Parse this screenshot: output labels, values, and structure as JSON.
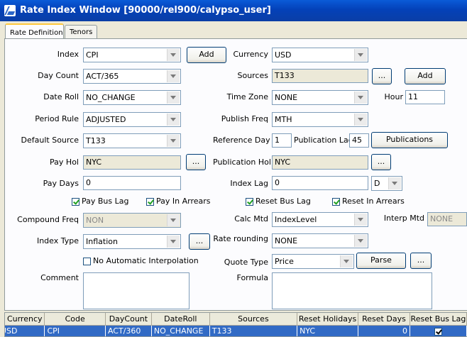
{
  "window": {
    "title": "Rate Index Window  [90000/rel900/calypso_user]"
  },
  "tabs": [
    {
      "label": "Rate Definition"
    },
    {
      "label": "Tenors"
    }
  ],
  "left": {
    "index": {
      "label": "Index",
      "value": "CPI",
      "button": "Add"
    },
    "day_count": {
      "label": "Day Count",
      "value": "ACT/365"
    },
    "date_roll": {
      "label": "Date Roll",
      "value": "NO_CHANGE"
    },
    "period_rule": {
      "label": "Period Rule",
      "value": "ADJUSTED"
    },
    "default_source": {
      "label": "Default Source",
      "value": "T133"
    },
    "pay_hol": {
      "label": "Pay Hol",
      "value": "NYC",
      "button": "..."
    },
    "pay_days": {
      "label": "Pay Days",
      "value": "0"
    },
    "pay_bus_lag": {
      "label": "Pay Bus Lag",
      "checked": true
    },
    "pay_in_arrears": {
      "label": "Pay In Arrears",
      "checked": true
    },
    "compound_freq": {
      "label": "Compound Freq",
      "value": "NON"
    },
    "index_type": {
      "label": "Index Type",
      "value": "Inflation",
      "button": "..."
    },
    "no_auto_interp": {
      "label": "No Automatic Interpolation",
      "checked": false
    },
    "comment": {
      "label": "Comment",
      "value": ""
    }
  },
  "right": {
    "currency": {
      "label": "Currency",
      "value": "USD"
    },
    "sources": {
      "label": "Sources",
      "value": "T133",
      "button_more": "...",
      "button_add": "Add"
    },
    "time_zone": {
      "label": "Time Zone",
      "value": "NONE"
    },
    "hour": {
      "label": "Hour",
      "value": "11"
    },
    "publish_freq": {
      "label": "Publish Freq",
      "value": "MTH"
    },
    "reference_day": {
      "label": "Reference Day",
      "value": "1"
    },
    "publication_lag": {
      "label": "Publication Lag",
      "value": "45"
    },
    "publications_button": "Publications",
    "publication_hol": {
      "label": "Publication Hol",
      "value": "NYC",
      "button": "..."
    },
    "index_lag": {
      "label": "Index Lag",
      "value": "0",
      "unit": "D"
    },
    "reset_bus_lag": {
      "label": "Reset Bus Lag",
      "checked": true
    },
    "reset_in_arrears": {
      "label": "Reset In Arrears",
      "checked": true
    },
    "calc_mtd": {
      "label": "Calc Mtd",
      "value": "IndexLevel"
    },
    "interp_mtd": {
      "label": "Interp Mtd",
      "value": "NONE"
    },
    "rate_rounding": {
      "label": "Rate rounding",
      "value": "NONE"
    },
    "quote_type": {
      "label": "Quote Type",
      "value": "Price",
      "button_parse": "Parse",
      "button_more": "..."
    },
    "formula": {
      "label": "Formula",
      "value": ""
    }
  },
  "table": {
    "columns": [
      "Currency",
      "Code",
      "DayCount",
      "DateRoll",
      "Sources",
      "Reset Holidays",
      "Reset Days",
      "Reset Bus Lag"
    ],
    "rows": [
      {
        "currency": "USD",
        "code": "CPI",
        "daycount": "ACT/360",
        "dateroll": "NO_CHANGE",
        "sources": "T133",
        "reset_holidays": "NYC",
        "reset_days": "0",
        "reset_bus_lag": true
      }
    ]
  },
  "colors": {
    "titlebar": "#0441b8",
    "selection": "#316ac5",
    "tab_highlight": "#ffc83c"
  }
}
